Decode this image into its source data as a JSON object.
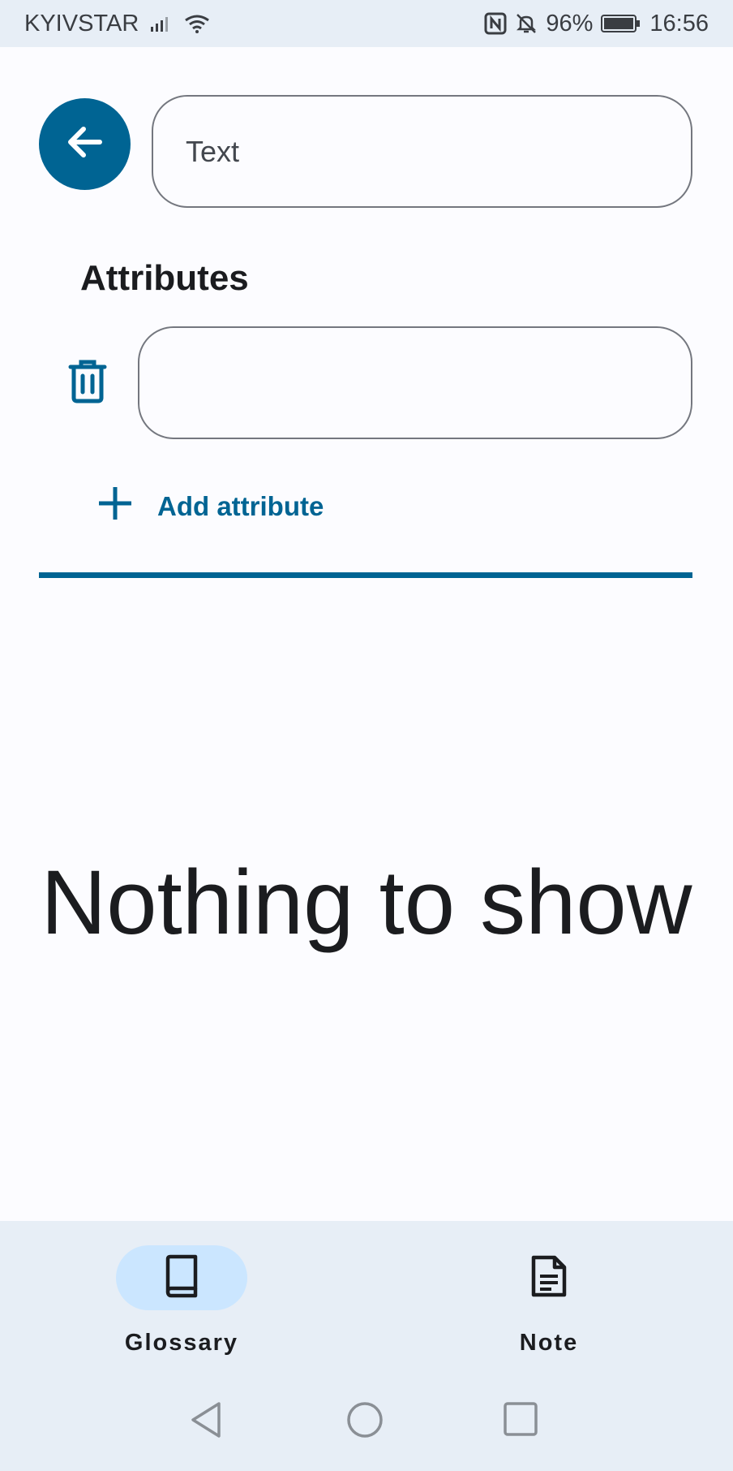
{
  "status_bar": {
    "carrier": "KYIVSTAR",
    "battery": "96%",
    "time": "16:56"
  },
  "header": {
    "title_value": "Text",
    "back_icon": "arrow-left-icon"
  },
  "attributes": {
    "heading": "Attributes",
    "items": [
      {
        "value": ""
      }
    ],
    "add_label": "Add attribute"
  },
  "content": {
    "empty_message": "Nothing to show"
  },
  "bottom_nav": {
    "items": [
      {
        "label": "Glossary",
        "icon": "book-icon",
        "active": true
      },
      {
        "label": "Note",
        "icon": "document-icon",
        "active": false
      }
    ]
  },
  "colors": {
    "primary": "#006493",
    "surface": "#fcfcff",
    "nav_background": "#e7eef6",
    "active_indicator": "#cbe6ff",
    "outline": "#74777f"
  }
}
